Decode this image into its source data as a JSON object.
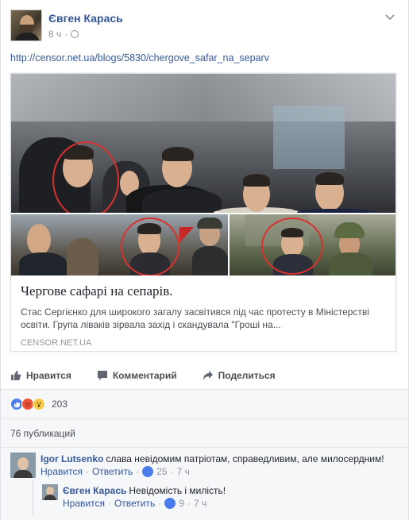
{
  "post": {
    "author": "Євген Карась",
    "time": "8 ч",
    "link": "http://censor.net.ua/blogs/5830/chergove_safar_na_separv",
    "preview": {
      "title": "Чергове сафарі на сепарів.",
      "description": "Стас Сергієнко для широкого загалу засвітився під час протесту в Міністерстві освіти. Група ліваків зірвала захід і скандувала \"Гроші на...",
      "source": "CENSOR.NET.UA"
    }
  },
  "actions": {
    "like": "Нравится",
    "comment": "Комментарий",
    "share": "Поделиться"
  },
  "reactions": {
    "count": "203",
    "icons": [
      "like-icon",
      "angry-icon",
      "wow-icon"
    ]
  },
  "shares": "76 публикаций",
  "comments": [
    {
      "author": "Igor Lutsenko",
      "text": "слава невідомим патріотам, справедливим, але милосердним!",
      "like_label": "Нравится",
      "reply_label": "Ответить",
      "likes": "25",
      "time": "7 ч"
    },
    {
      "author": "Євген Карась",
      "text": "Невідомість і милість!",
      "like_label": "Нравится",
      "reply_label": "Ответить",
      "likes": "9",
      "time": "7 ч"
    }
  ],
  "colors": {
    "link": "#365899",
    "meta": "#90949c",
    "ring": "#d9322e",
    "like": "#4b7bec"
  }
}
